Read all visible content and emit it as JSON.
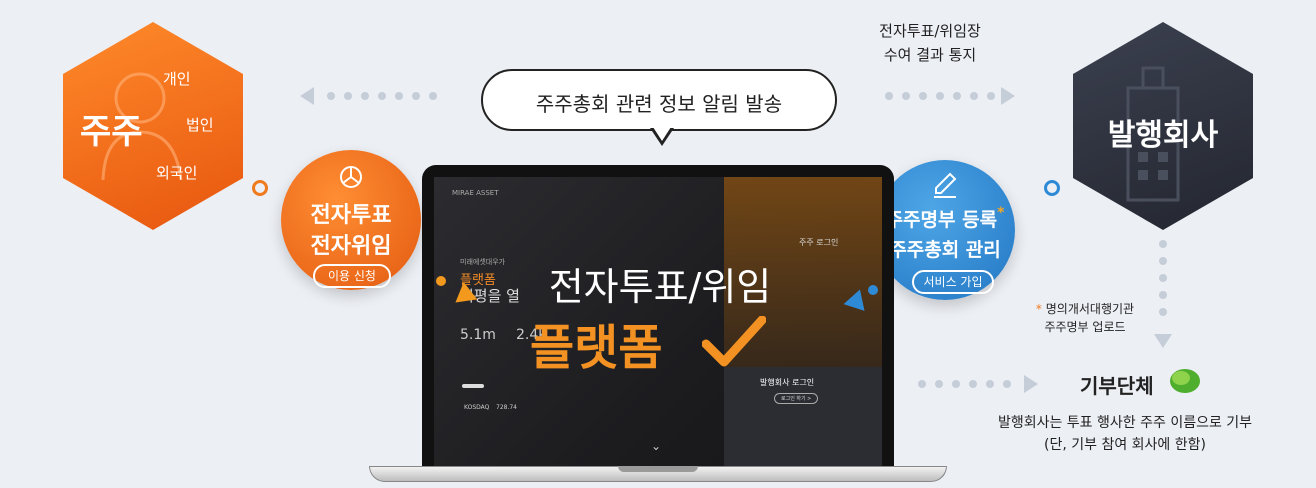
{
  "shareholder": {
    "title": "주주",
    "types": [
      "개인",
      "법인",
      "외국인"
    ]
  },
  "issuer": {
    "title": "발행회사"
  },
  "bubble": {
    "text": "주주총회 관련 정보 알림 발송"
  },
  "top_right_note": {
    "line1": "전자투표/위임장",
    "line2": "수여 결과 통지"
  },
  "left_service": {
    "line1": "전자투표",
    "line2": "전자위임",
    "button": "이용 신청",
    "icon": "pie-chart-icon"
  },
  "right_service": {
    "line1": "주주명부 등록",
    "line1_mark": "*",
    "line2": "주주총회 관리",
    "button": "서비스 가입",
    "icon": "pencil-icon"
  },
  "register_note": {
    "mark": "*",
    "line1": "명의개서대행기관",
    "line2": "주주명부 업로드"
  },
  "platform": {
    "line1": "전자투표/위임",
    "line2": "플랫폼"
  },
  "screen": {
    "login_label": "주주 로그인",
    "company_login": "발행회사 로그인",
    "company_login_btn": "로그인 하기 >",
    "stat1": "5.1m",
    "stat2": "2.4k",
    "ticker_name": "KOSDAQ",
    "ticker_value": "728.74",
    "headline_pre": "미래에셋대우가",
    "headline1": "플랫폼",
    "headline2": "지평을 열"
  },
  "donation": {
    "title": "기부단체",
    "line1": "발행회사는 투표 행사한 주주 이름으로 기부",
    "line2": "(단, 기부 참여 회사에 한함)"
  },
  "colors": {
    "orange": "#f07a1e",
    "blue": "#2f8ad6",
    "dark": "#2b2f3a",
    "green": "#4fae2e"
  }
}
